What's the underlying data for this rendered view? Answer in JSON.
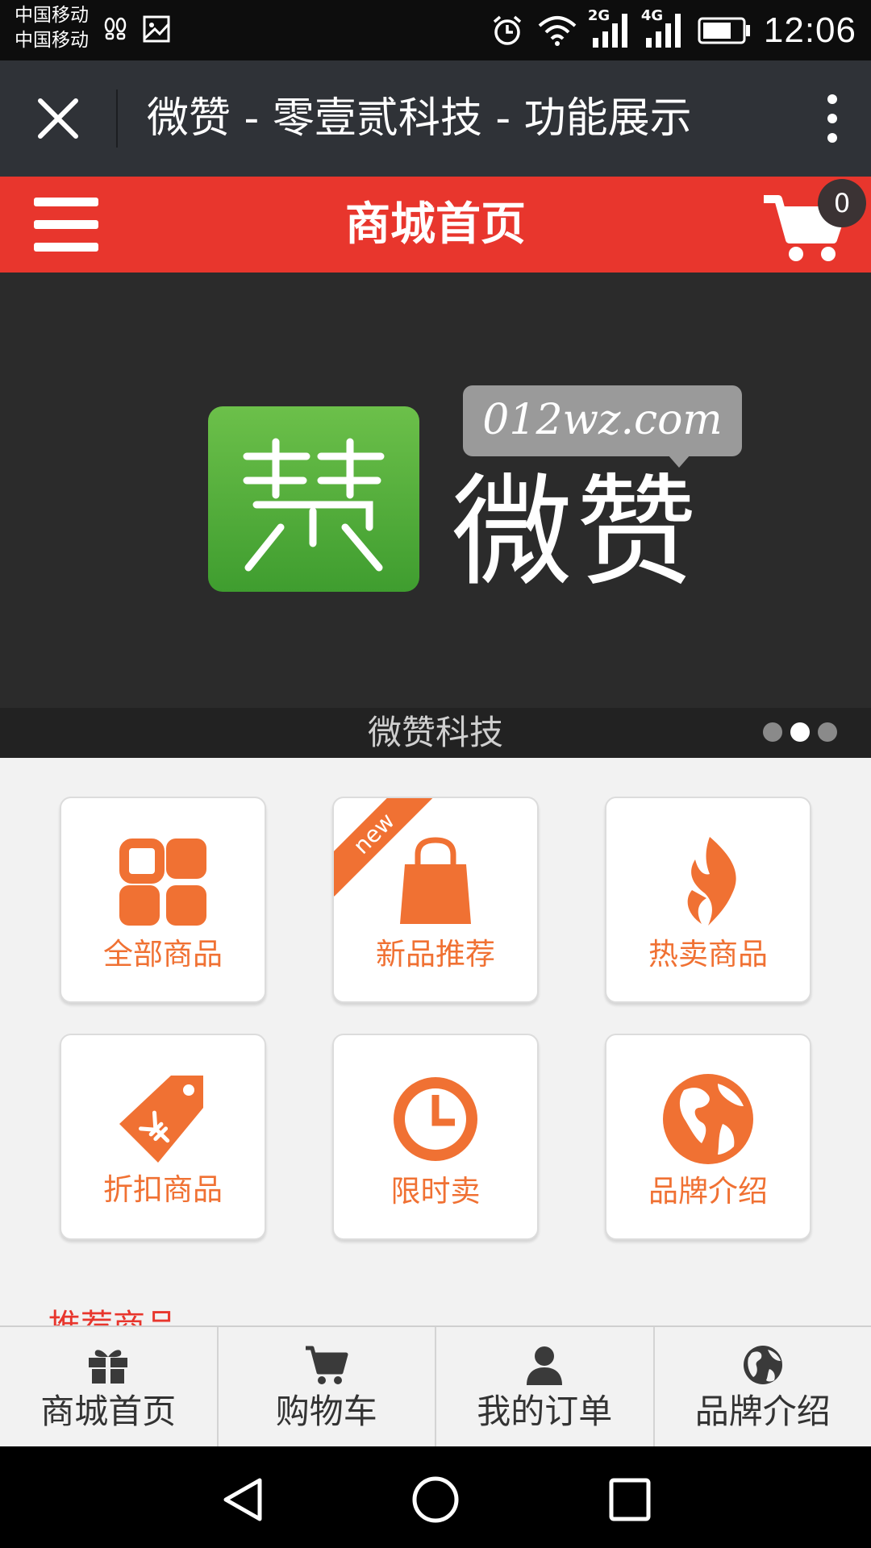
{
  "status_bar": {
    "carrier1": "中国移动",
    "carrier2": "中国移动",
    "network1": "2G",
    "network2": "4G",
    "time": "12:06"
  },
  "titlebar": {
    "title": "微赞 - 零壹贰科技 - 功能展示"
  },
  "header": {
    "title": "商城首页",
    "cart_count": "0"
  },
  "banner": {
    "logo_badge_text": "012wz.com",
    "logo_text": "微赞",
    "caption": "微赞科技",
    "slides_total": 3,
    "active_slide": 2
  },
  "tiles": [
    {
      "label": "全部商品",
      "icon": "grid-icon"
    },
    {
      "label": "新品推荐",
      "icon": "shopping-bag-icon",
      "ribbon": "new"
    },
    {
      "label": "热卖商品",
      "icon": "flame-icon"
    },
    {
      "label": "折扣商品",
      "icon": "price-tag-icon"
    },
    {
      "label": "限时卖",
      "icon": "clock-icon"
    },
    {
      "label": "品牌介绍",
      "icon": "globe-icon"
    }
  ],
  "section_title": "推荐商品",
  "bottom_nav": [
    {
      "label": "商城首页",
      "icon": "gift-icon"
    },
    {
      "label": "购物车",
      "icon": "cart-icon"
    },
    {
      "label": "我的订单",
      "icon": "user-icon"
    },
    {
      "label": "品牌介绍",
      "icon": "globe-icon"
    }
  ],
  "colors": {
    "brand_red": "#e8362d",
    "accent_orange": "#f07133",
    "logo_green": "#4caf3c",
    "titlebar_bg": "#2f3237"
  }
}
